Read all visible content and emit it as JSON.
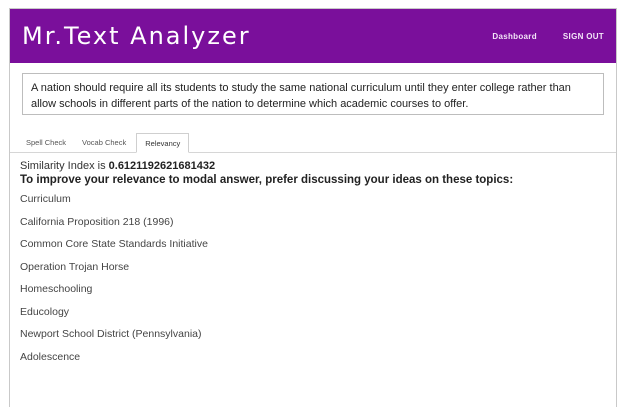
{
  "header": {
    "brand": "Mr.Text Analyzer",
    "nav": [
      "Dashboard",
      "SIGN OUT"
    ]
  },
  "prompt_text": "A nation should require all its students to study the same national curriculum until they enter college rather than allow schools in different parts of the nation to determine which academic courses to offer.",
  "tabs": [
    "Spell Check",
    "Vocab Check",
    "Relevancy"
  ],
  "active_tab": "Relevancy",
  "result": {
    "similarity_label": "Similarity Index is ",
    "similarity_value": "0.6121192621681432",
    "advice": "To improve your relevance to modal answer, prefer discussing your ideas on these topics:"
  },
  "topics": [
    "Curriculum",
    "California Proposition 218 (1996)",
    "Common Core State Standards Initiative",
    "Operation Trojan Horse",
    "Homeschooling",
    "Educology",
    "Newport School District (Pennsylvania)",
    "Adolescence"
  ],
  "colors": {
    "header_bg": "#7a0f9b",
    "header_text": "#ffffff"
  }
}
